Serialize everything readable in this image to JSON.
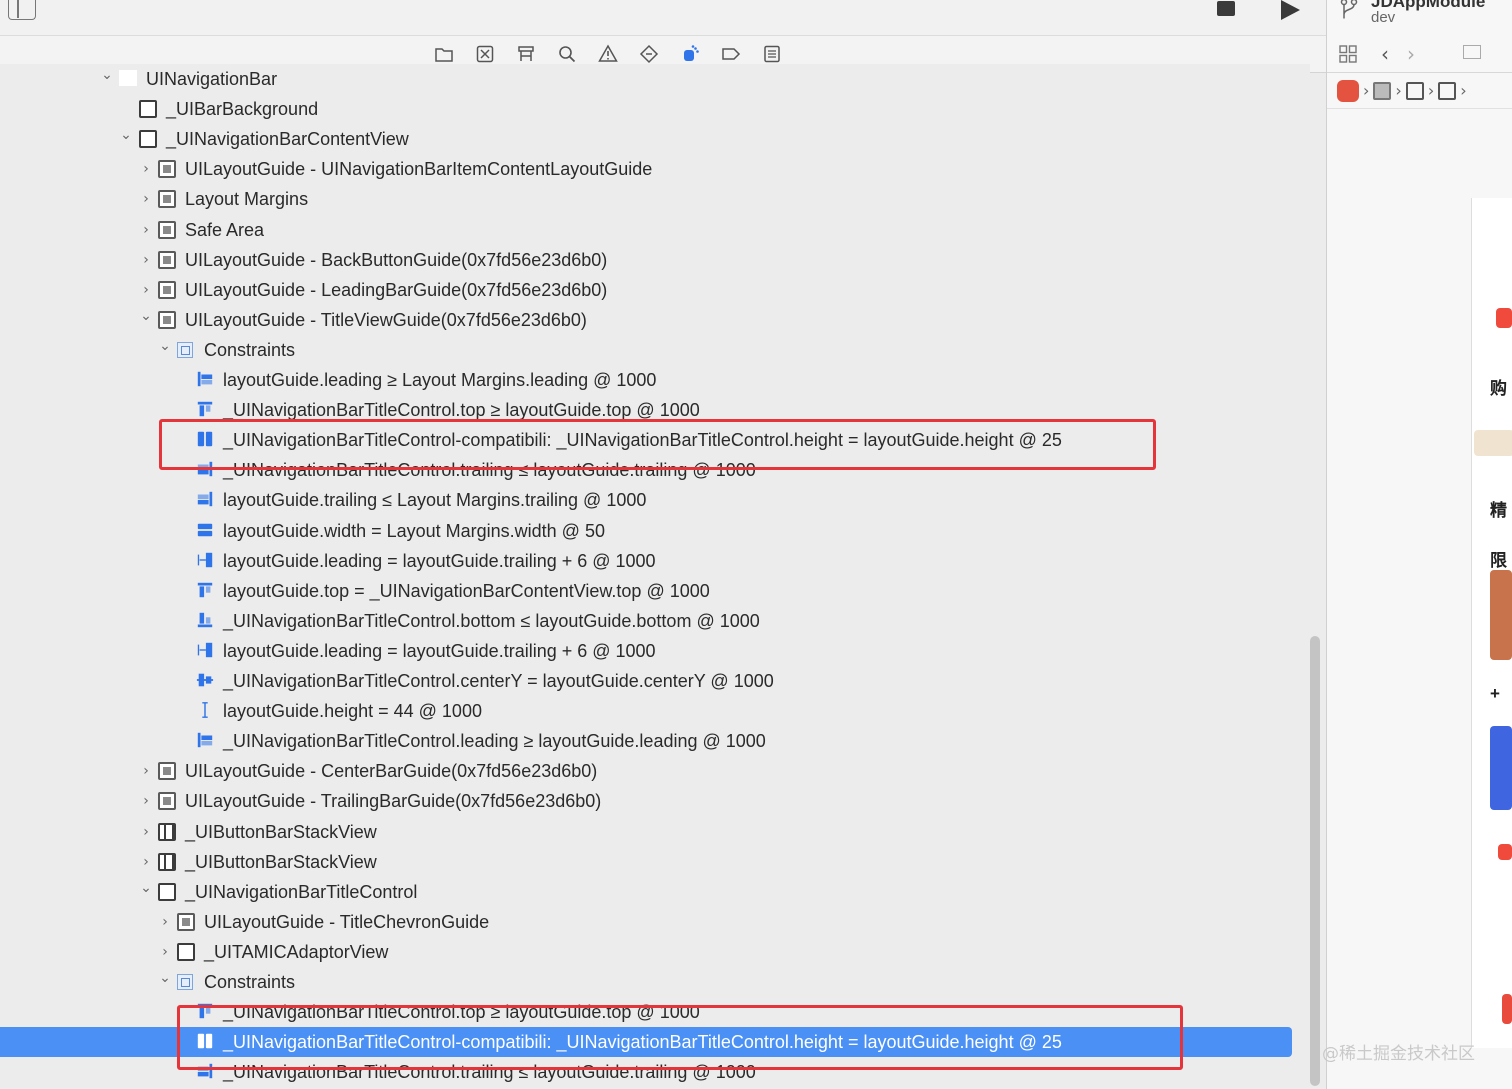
{
  "toolbar": {
    "scheme": "JDAppModule",
    "branch": "dev"
  },
  "navigator": {
    "icons": [
      "folder-icon",
      "source-control-icon",
      "symbol-icon",
      "find-icon",
      "issue-icon",
      "test-icon",
      "debug-icon",
      "breakpoint-icon",
      "report-icon"
    ],
    "active_icon": "debug-icon"
  },
  "tree": {
    "rows": [
      {
        "label": "UINavigationBar",
        "depth": 0,
        "chevron": "down",
        "icon": "blank"
      },
      {
        "label": "_UIBarBackground",
        "depth": 1,
        "chevron": "none",
        "icon": "view"
      },
      {
        "label": "_UINavigationBarContentView",
        "depth": 1,
        "chevron": "down",
        "icon": "view"
      },
      {
        "label": "UILayoutGuide - UINavigationBarItemContentLayoutGuide",
        "depth": 2,
        "chevron": "right",
        "icon": "guide"
      },
      {
        "label": "Layout Margins",
        "depth": 2,
        "chevron": "right",
        "icon": "guide"
      },
      {
        "label": "Safe Area",
        "depth": 2,
        "chevron": "right",
        "icon": "guide"
      },
      {
        "label": "UILayoutGuide - BackButtonGuide(0x7fd56e23d6b0)",
        "depth": 2,
        "chevron": "right",
        "icon": "guide"
      },
      {
        "label": "UILayoutGuide - LeadingBarGuide(0x7fd56e23d6b0)",
        "depth": 2,
        "chevron": "right",
        "icon": "guide"
      },
      {
        "label": "UILayoutGuide - TitleViewGuide(0x7fd56e23d6b0)",
        "depth": 2,
        "chevron": "down",
        "icon": "guide"
      },
      {
        "label": "Constraints",
        "depth": 3,
        "chevron": "down",
        "icon": "constraints"
      },
      {
        "label": "layoutGuide.leading ≥ Layout Margins.leading @ 1000",
        "depth": 4,
        "chevron": "none",
        "icon": "c-leading"
      },
      {
        "label": "_UINavigationBarTitleControl.top ≥ layoutGuide.top @ 1000",
        "depth": 4,
        "chevron": "none",
        "icon": "c-top"
      },
      {
        "label": "_UINavigationBarTitleControl-compatibili: _UINavigationBarTitleControl.height = layoutGuide.height @ 25",
        "depth": 4,
        "chevron": "none",
        "icon": "c-height"
      },
      {
        "label": "_UINavigationBarTitleControl.trailing ≤ layoutGuide.trailing @ 1000",
        "depth": 4,
        "chevron": "none",
        "icon": "c-trailing"
      },
      {
        "label": "layoutGuide.trailing ≤ Layout Margins.trailing @ 1000",
        "depth": 4,
        "chevron": "none",
        "icon": "c-trailing"
      },
      {
        "label": "layoutGuide.width = Layout Margins.width @ 50",
        "depth": 4,
        "chevron": "none",
        "icon": "c-width"
      },
      {
        "label": "layoutGuide.leading = layoutGuide.trailing + 6 @ 1000",
        "depth": 4,
        "chevron": "none",
        "icon": "c-space"
      },
      {
        "label": "layoutGuide.top = _UINavigationBarContentView.top @ 1000",
        "depth": 4,
        "chevron": "none",
        "icon": "c-top"
      },
      {
        "label": "_UINavigationBarTitleControl.bottom ≤ layoutGuide.bottom @ 1000",
        "depth": 4,
        "chevron": "none",
        "icon": "c-bottom"
      },
      {
        "label": "layoutGuide.leading = layoutGuide.trailing + 6 @ 1000",
        "depth": 4,
        "chevron": "none",
        "icon": "c-space"
      },
      {
        "label": "_UINavigationBarTitleControl.centerY = layoutGuide.centerY @ 1000",
        "depth": 4,
        "chevron": "none",
        "icon": "c-center"
      },
      {
        "label": "layoutGuide.height = 44 @ 1000",
        "depth": 4,
        "chevron": "none",
        "icon": "c-ibeam"
      },
      {
        "label": "_UINavigationBarTitleControl.leading ≥ layoutGuide.leading @ 1000",
        "depth": 4,
        "chevron": "none",
        "icon": "c-leading"
      },
      {
        "label": "UILayoutGuide - CenterBarGuide(0x7fd56e23d6b0)",
        "depth": 2,
        "chevron": "right",
        "icon": "guide"
      },
      {
        "label": "UILayoutGuide - TrailingBarGuide(0x7fd56e23d6b0)",
        "depth": 2,
        "chevron": "right",
        "icon": "guide"
      },
      {
        "label": "_UIButtonBarStackView",
        "depth": 2,
        "chevron": "right",
        "icon": "stack"
      },
      {
        "label": "_UIButtonBarStackView",
        "depth": 2,
        "chevron": "right",
        "icon": "stack"
      },
      {
        "label": "_UINavigationBarTitleControl",
        "depth": 2,
        "chevron": "down",
        "icon": "view"
      },
      {
        "label": "UILayoutGuide - TitleChevronGuide",
        "depth": 3,
        "chevron": "right",
        "icon": "guide"
      },
      {
        "label": "_UITAMICAdaptorView",
        "depth": 3,
        "chevron": "right",
        "icon": "view"
      },
      {
        "label": "Constraints",
        "depth": 3,
        "chevron": "down",
        "icon": "constraints"
      },
      {
        "label": "_UINavigationBarTitleControl.top ≥ layoutGuide.top @ 1000",
        "depth": 4,
        "chevron": "none",
        "icon": "c-top"
      },
      {
        "label": "_UINavigationBarTitleControl-compatibili: _UINavigationBarTitleControl.height = layoutGuide.height @ 25",
        "depth": 4,
        "chevron": "none",
        "icon": "c-height",
        "selected": true
      },
      {
        "label": "_UINavigationBarTitleControl.trailing ≤ layoutGuide.trailing @ 1000",
        "depth": 4,
        "chevron": "none",
        "icon": "c-trailing"
      }
    ]
  },
  "preview": {
    "chars": [
      "购",
      "精",
      "限",
      "+"
    ]
  },
  "watermark": "@稀土掘金技术社区",
  "colors": {
    "accent": "#4a90f5",
    "highlight": "#e6353a",
    "constraint_icon": "#2f74e8"
  }
}
